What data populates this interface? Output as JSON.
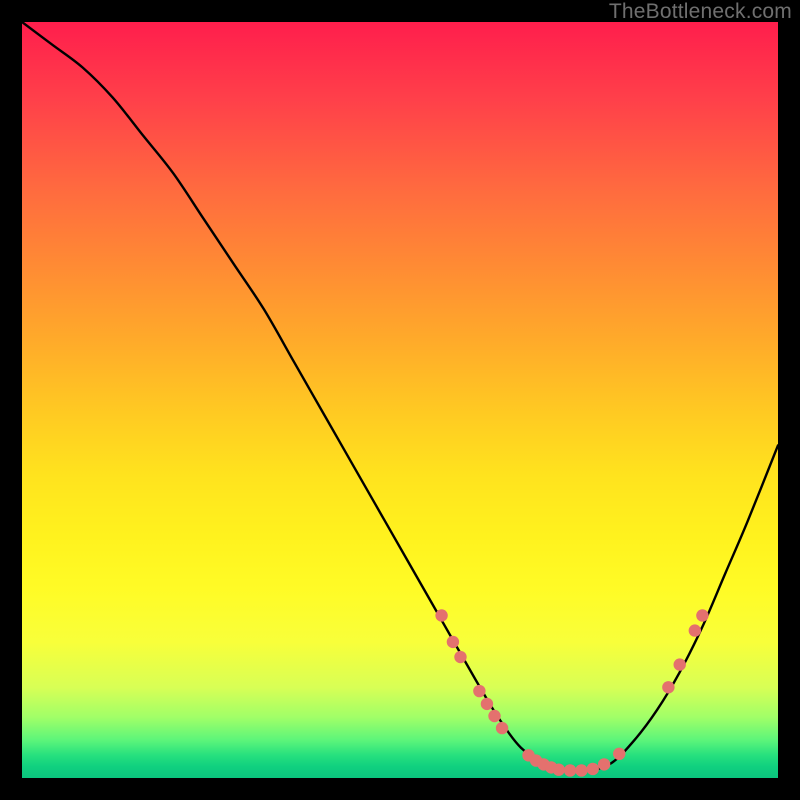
{
  "watermark": "TheBottleneck.com",
  "colors": {
    "curve": "#000000",
    "marker": "#e4716e",
    "background_top": "#ff1e4c",
    "background_bottom": "#0bc57e"
  },
  "chart_data": {
    "type": "line",
    "title": "",
    "xlabel": "",
    "ylabel": "",
    "xlim": [
      0,
      100
    ],
    "ylim": [
      0,
      100
    ],
    "x": [
      0,
      4,
      8,
      12,
      16,
      20,
      24,
      28,
      32,
      36,
      40,
      44,
      48,
      52,
      56,
      60,
      63,
      66,
      69,
      72,
      75,
      78,
      81,
      84,
      87,
      90,
      93,
      96,
      100
    ],
    "y": [
      100,
      97,
      94,
      90,
      85,
      80,
      74,
      68,
      62,
      55,
      48,
      41,
      34,
      27,
      20,
      13,
      8,
      4,
      2,
      1,
      1,
      2,
      5,
      9,
      14,
      20,
      27,
      34,
      44
    ],
    "marker_points": [
      {
        "x": 55.5,
        "y": 21.5
      },
      {
        "x": 57.0,
        "y": 18.0
      },
      {
        "x": 58.0,
        "y": 16.0
      },
      {
        "x": 60.5,
        "y": 11.5
      },
      {
        "x": 61.5,
        "y": 9.8
      },
      {
        "x": 62.5,
        "y": 8.2
      },
      {
        "x": 63.5,
        "y": 6.6
      },
      {
        "x": 67.0,
        "y": 3.0
      },
      {
        "x": 68.0,
        "y": 2.3
      },
      {
        "x": 69.0,
        "y": 1.8
      },
      {
        "x": 70.0,
        "y": 1.4
      },
      {
        "x": 71.0,
        "y": 1.1
      },
      {
        "x": 72.5,
        "y": 1.0
      },
      {
        "x": 74.0,
        "y": 1.0
      },
      {
        "x": 75.5,
        "y": 1.2
      },
      {
        "x": 77.0,
        "y": 1.8
      },
      {
        "x": 79.0,
        "y": 3.2
      },
      {
        "x": 85.5,
        "y": 12.0
      },
      {
        "x": 87.0,
        "y": 15.0
      },
      {
        "x": 89.0,
        "y": 19.5
      },
      {
        "x": 90.0,
        "y": 21.5
      }
    ],
    "marker_radius": 6.2
  }
}
